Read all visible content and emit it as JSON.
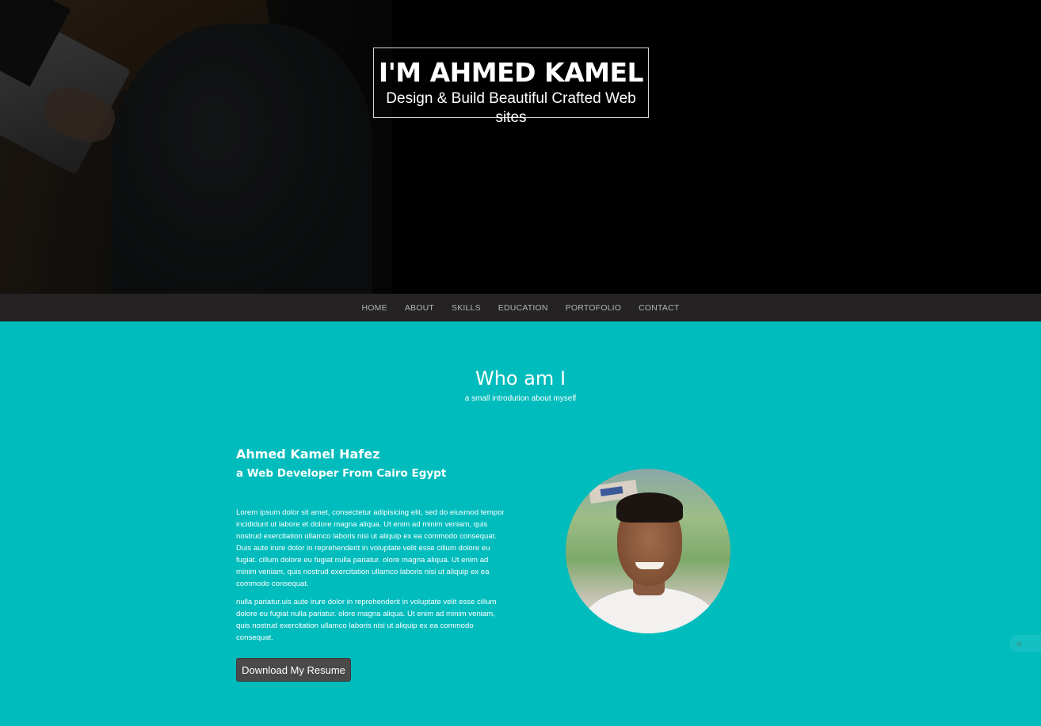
{
  "hero": {
    "title": "I'M AHMED KAMEL",
    "subtitle": "Design & Build Beautiful Crafted Web sites"
  },
  "nav": {
    "items": [
      "HOME",
      "ABOUT",
      "SKILLS",
      "EDUCATION",
      "PORTOFOLIO",
      "CONTACT"
    ]
  },
  "about": {
    "heading": "Who am I",
    "subheading": "a small introdution about myself",
    "name": "Ahmed Kamel Hafez",
    "role": "a Web Developer From Cairo Egypt",
    "paragraph_1": "Lorem ipsum dolor sit amet, consectetur adipisicing elit, sed do eiusmod tempor incididunt ut labore et dolore magna aliqua. Ut enim ad minim veniam, quis nostrud exercitation ullamco laboris nisi ut aliquip ex ea commodo consequat. Duis aute irure dolor in reprehenderit in voluptate velit esse cillum dolore eu fugiat. cillum dolore eu fugiat nulla pariatur. olore magna aliqua. Ut enim ad minim veniam, quis nostrud exercitation ullamco laboris nisi ut aliquip ex ea commodo consequat.",
    "paragraph_2": "nulla pariatur.uis aute irure dolor in reprehenderit in voluptate velit esse cillum dolore eu fugiat nulla pariatur. olore magna aliqua. Ut enim ad minim veniam, quis nostrud exercitation ullamco laboris nisi ut aliquip ex ea commodo consequat.",
    "resume_button": "Download My Resume"
  },
  "colors": {
    "accent": "#00bcbd",
    "nav_bg": "#242223",
    "button_bg": "#4a4a4a"
  }
}
